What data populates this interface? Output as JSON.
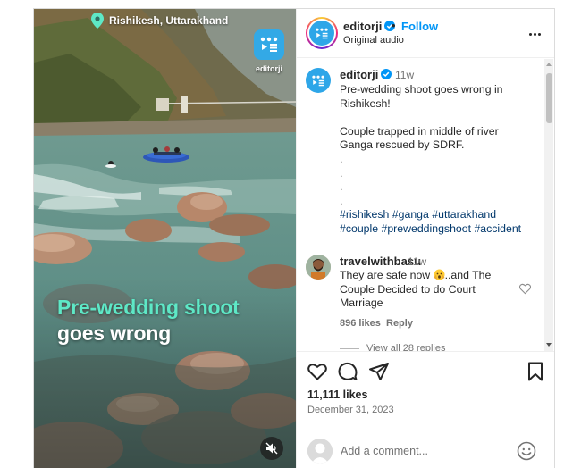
{
  "video": {
    "location": "Rishikesh, Uttarakhand",
    "brand_name": "editorji",
    "overlay_line1": "Pre-wedding shoot",
    "overlay_line2": "goes wrong",
    "mute_icon": "speaker-muted-icon"
  },
  "header": {
    "username": "editorji",
    "separator": "•",
    "follow_label": "Follow",
    "audio": "Original audio"
  },
  "caption": {
    "username": "editorji",
    "time": "11w",
    "text": "Pre-wedding shoot goes wrong in Rishikesh!\n\nCouple trapped in middle of river Ganga rescued by SDRF.\n.\n.\n.\n.",
    "hashtags": [
      "#rishikesh",
      "#ganga",
      "#uttarakhand",
      "#couple",
      "#preweddingshoot",
      "#accident"
    ]
  },
  "comment": {
    "username": "travelwithbasu",
    "time": "11w",
    "text_before": "They are safe now ",
    "text_after": "..and The Couple Decided to do Court Marriage",
    "likes": "896 likes",
    "reply_label": "Reply",
    "view_replies": "View all 28 replies"
  },
  "footer": {
    "likes": "11,111 likes",
    "date": "December 31, 2023",
    "comment_placeholder": "Add a comment..."
  },
  "colors": {
    "accent": "#0095f6",
    "brand_blue": "#2ea6e8",
    "overlay_green": "#5ee8c6"
  }
}
